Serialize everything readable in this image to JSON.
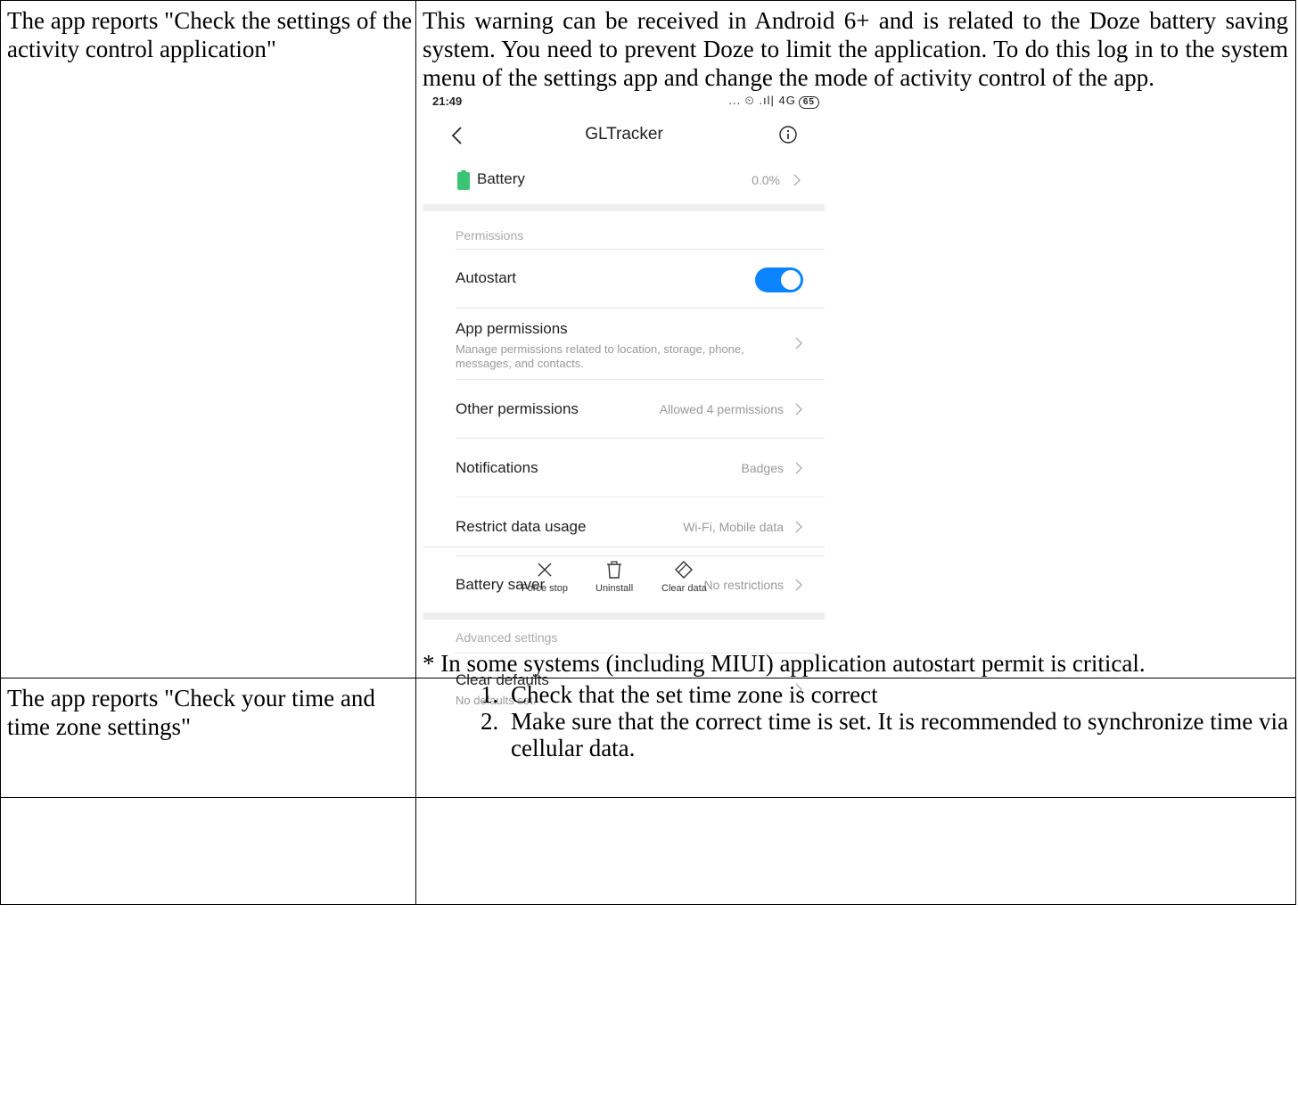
{
  "rows": [
    {
      "problem": "The app reports \"Check the settings of the activity control application\"",
      "solution": "This warning can be received in Android 6+ and is related to the Doze battery saving system. You need to prevent Doze to limit the application. To do this log in to the system menu of the settings app and change the mode of activity control of the app.",
      "note": "* In some systems (including MIUI) application autostart permit is critical."
    },
    {
      "problem": "The app reports \"Check your time and time zone settings\"",
      "steps": [
        {
          "num": "1.",
          "text": "Check that the set time zone is correct"
        },
        {
          "num": "2.",
          "text": "Make sure that the correct time is set. It is recommended to synchronize time via cellular data."
        }
      ]
    }
  ],
  "phone": {
    "status": {
      "time": "21:49",
      "icons": "... ⏲ .ıl| 4G",
      "battery": "65"
    },
    "title": "GLTracker",
    "battery": {
      "label": "Battery",
      "value": "0.0%"
    },
    "permissions_header": "Permissions",
    "autostart": {
      "label": "Autostart",
      "enabled": true
    },
    "app_permissions": {
      "label": "App permissions",
      "sub": "Manage permissions related to location, storage, phone, messages, and contacts."
    },
    "other_permissions": {
      "label": "Other permissions",
      "value": "Allowed 4 permissions"
    },
    "notifications": {
      "label": "Notifications",
      "value": "Badges"
    },
    "restrict_data": {
      "label": "Restrict data usage",
      "value": "Wi-Fi, Mobile data"
    },
    "battery_saver": {
      "label": "Battery saver",
      "value": "No restrictions"
    },
    "advanced_header": "Advanced settings",
    "clear_defaults": {
      "label": "Clear defaults",
      "sub": "No defaults set."
    },
    "actions": {
      "force_stop": "Force stop",
      "uninstall": "Uninstall",
      "clear_data": "Clear data"
    },
    "colors": {
      "toggle": "#0d84ff",
      "battery_icon": "#3cc476"
    }
  }
}
